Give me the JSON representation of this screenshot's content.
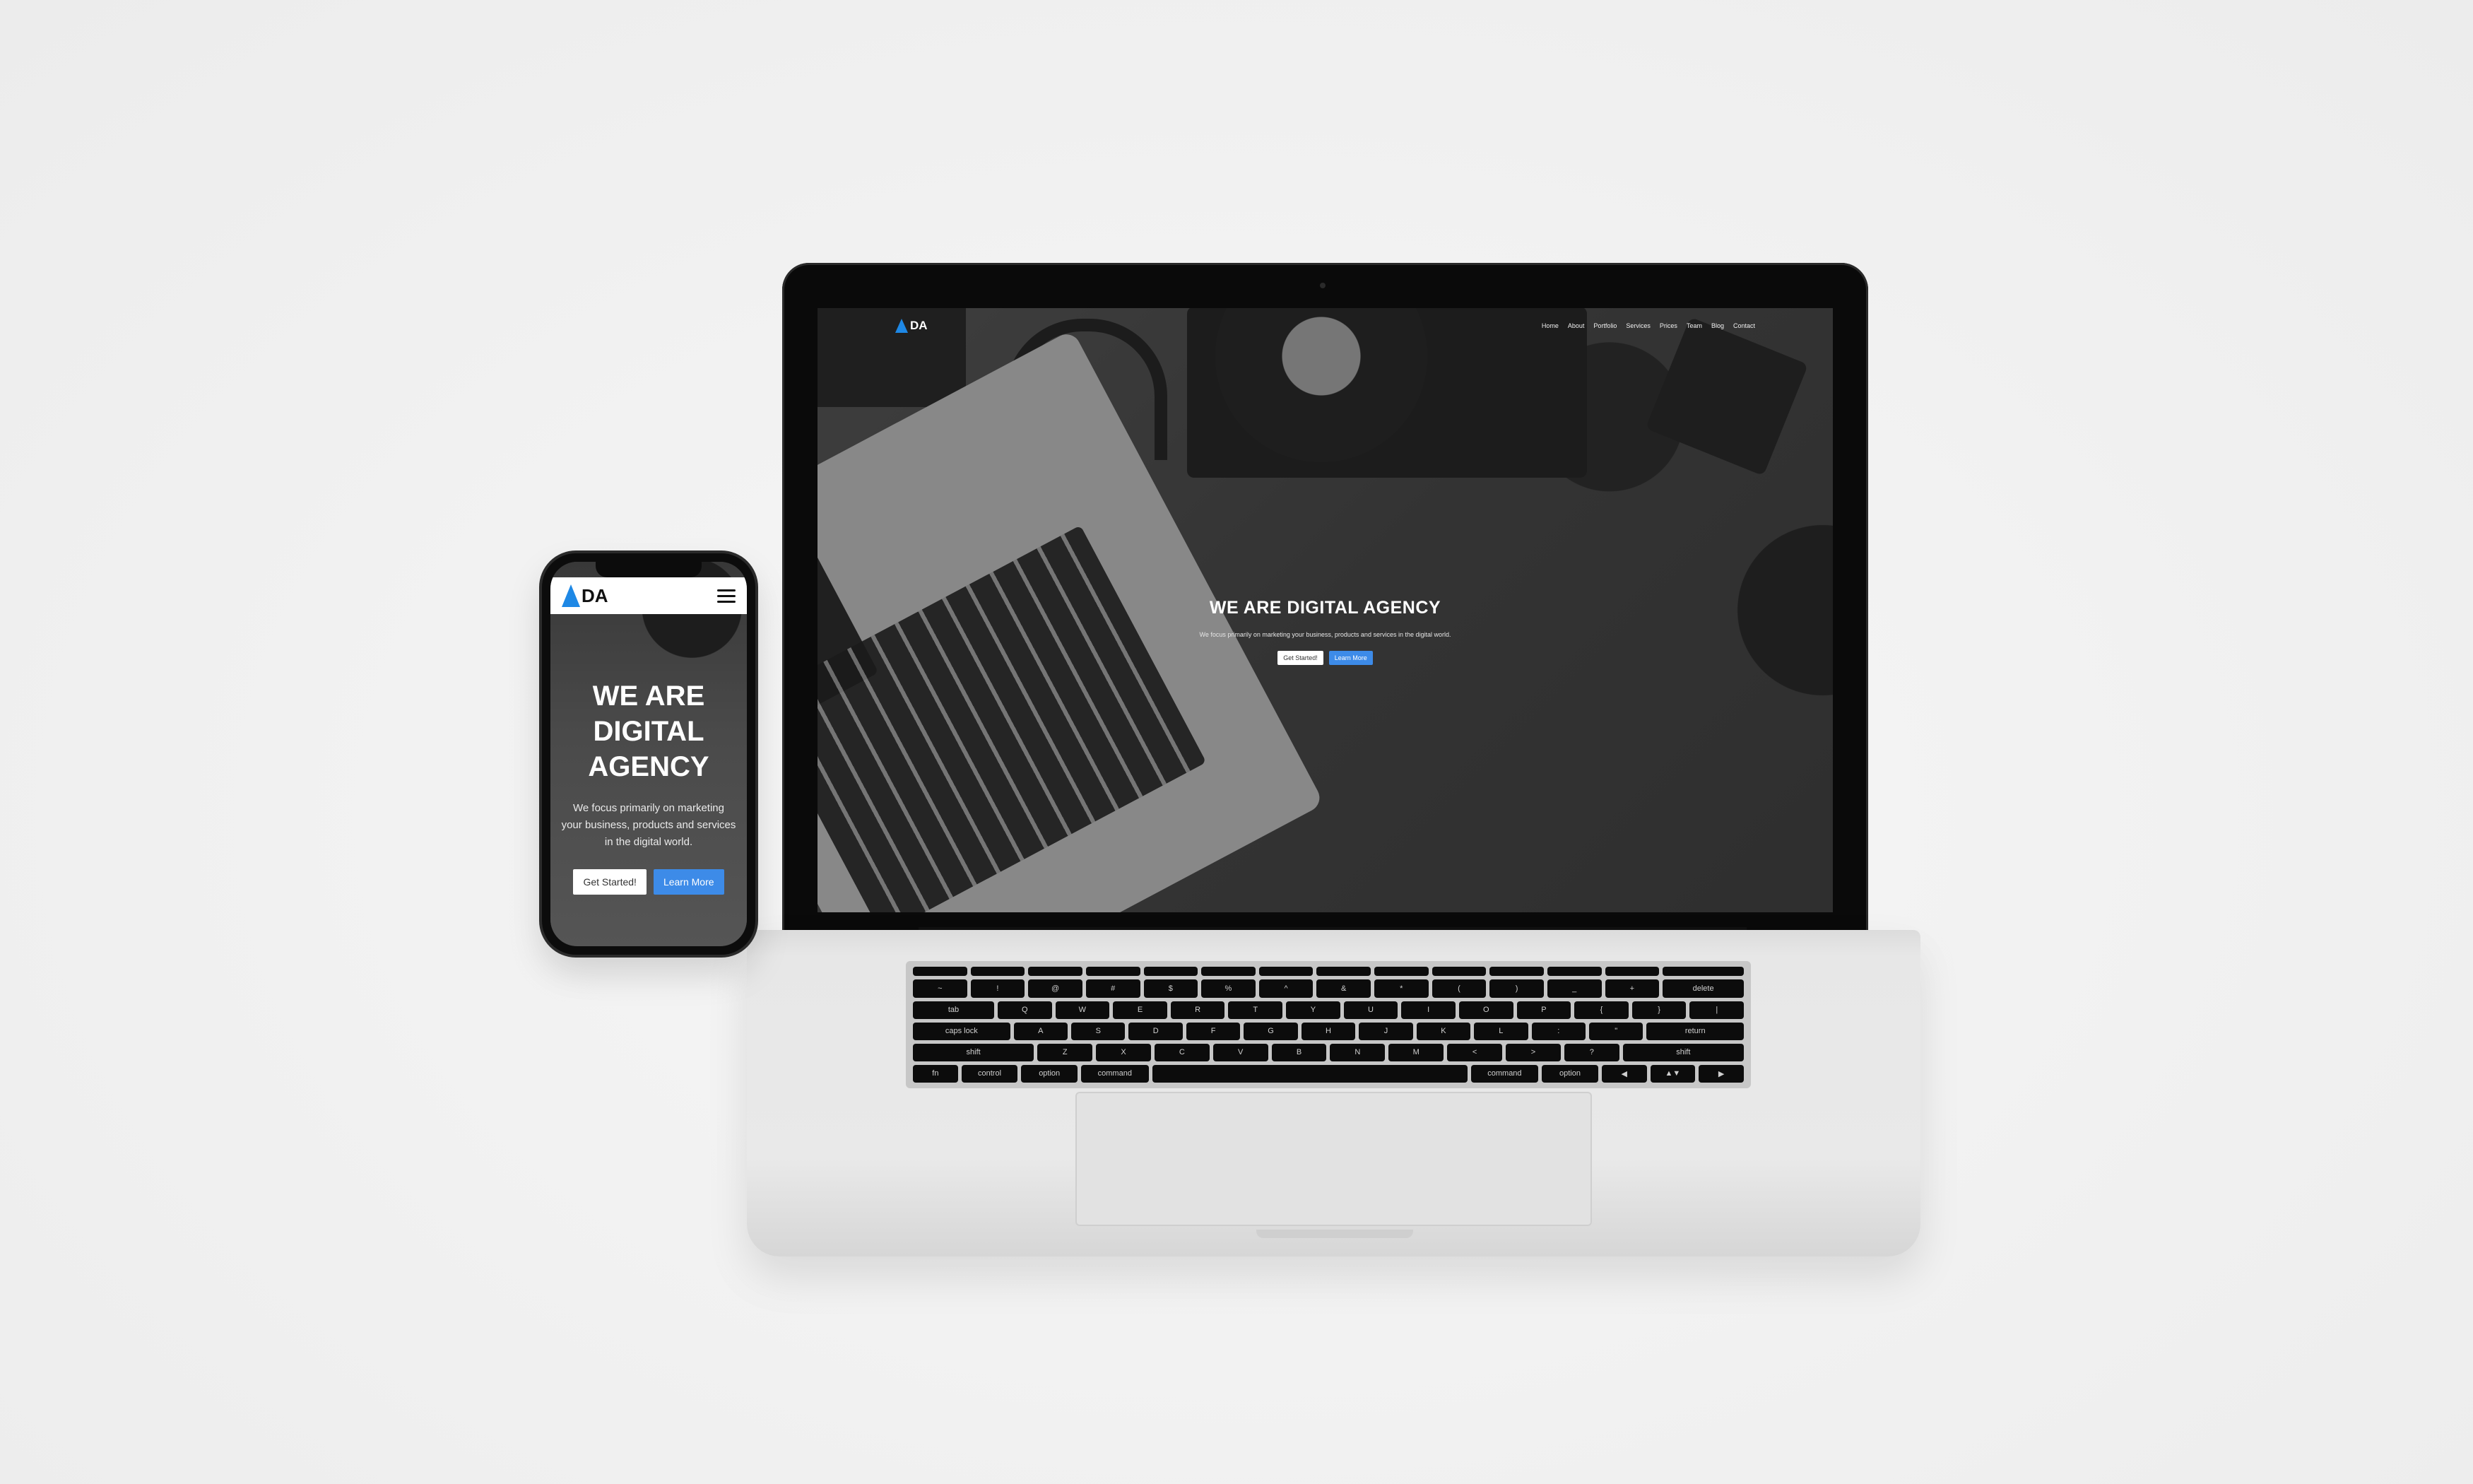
{
  "site": {
    "logo_text": "DA",
    "nav": [
      "Home",
      "About",
      "Portfolio",
      "Services",
      "Prices",
      "Team",
      "Blog",
      "Contact"
    ],
    "hero": {
      "title": "WE ARE DIGITAL AGENCY",
      "subtitle": "We focus primarily on marketing your business, products and services in the digital world.",
      "primary_button": "Get Started!",
      "secondary_button": "Learn More"
    }
  },
  "mobile": {
    "title_lines": [
      "WE ARE",
      "DIGITAL",
      "AGENCY"
    ],
    "subtitle_lines": [
      "We focus primarily on marketing",
      "your business, products and services",
      "in the digital world."
    ]
  },
  "keyboard": {
    "row1": [
      "~",
      "!",
      "@",
      "#",
      "$",
      "%",
      "^",
      "&",
      "*",
      "(",
      ")",
      "_",
      "+",
      "delete"
    ],
    "row2": [
      "tab",
      "Q",
      "W",
      "E",
      "R",
      "T",
      "Y",
      "U",
      "I",
      "O",
      "P",
      "{",
      "}",
      "|"
    ],
    "row3": [
      "caps lock",
      "A",
      "S",
      "D",
      "F",
      "G",
      "H",
      "J",
      "K",
      "L",
      ":",
      "\"",
      "return"
    ],
    "row4": [
      "shift",
      "Z",
      "X",
      "C",
      "V",
      "B",
      "N",
      "M",
      "<",
      ">",
      "?",
      "shift"
    ],
    "row5": [
      "fn",
      "control",
      "option",
      "command",
      "",
      "command",
      "option",
      "◀",
      "▲▼",
      "▶"
    ]
  },
  "colors": {
    "accent": "#3d8be8",
    "logo_blue": "#1e88e5"
  }
}
